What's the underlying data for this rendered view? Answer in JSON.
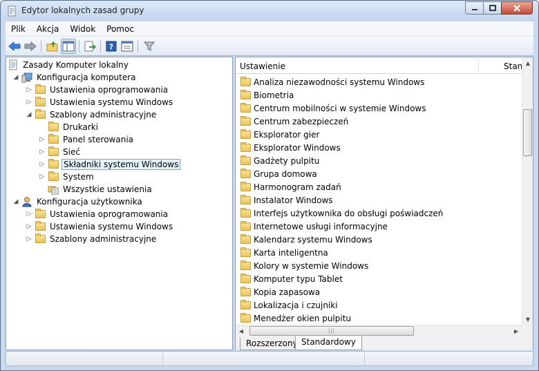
{
  "window": {
    "title": "Edytor lokalnych zasad grupy",
    "controls": [
      "minimize-icon",
      "maximize-icon",
      "close-icon"
    ]
  },
  "menu": [
    {
      "label": "Plik"
    },
    {
      "label": "Akcja"
    },
    {
      "label": "Widok"
    },
    {
      "label": "Pomoc"
    }
  ],
  "toolbar": {
    "icons": [
      "back-arrow-icon",
      "forward-arrow-icon",
      "up-folder-icon",
      "show-hide-tree-icon",
      "export-list-icon",
      "help-icon",
      "properties-icon",
      "filter-icon"
    ]
  },
  "tree": {
    "root": "Zasady Komputer lokalny",
    "computer": "Konfiguracja komputera",
    "computer_software": "Ustawienia oprogramowania",
    "computer_windows": "Ustawienia systemu Windows",
    "computer_admin": "Szablony administracyjne",
    "printers": "Drukarki",
    "control_panel": "Panel sterowania",
    "network": "Sieć",
    "win_components": "Składniki systemu Windows",
    "system": "System",
    "all_settings": "Wszystkie ustawienia",
    "user": "Konfiguracja użytkownika",
    "user_software": "Ustawienia oprogramowania",
    "user_windows": "Ustawienia systemu Windows",
    "user_admin": "Szablony administracyjne"
  },
  "list": {
    "col_setting": "Ustawienie",
    "col_state": "Stan",
    "items": [
      "Analiza niezawodności systemu Windows",
      "Biometria",
      "Centrum mobilności w systemie Windows",
      "Centrum zabezpieczeń",
      "Eksplorator gier",
      "Eksplorator Windows",
      "Gadżety pulpitu",
      "Grupa domowa",
      "Harmonogram zadań",
      "Instalator Windows",
      "Interfejs użytkownika do obsługi poświadczeń",
      "Internetowe usługi informacyjne",
      "Kalendarz systemu Windows",
      "Karta inteligentna",
      "Kolory w systemie Windows",
      "Komputer typu Tablet",
      "Kopia zapasowa",
      "Lokalizacja i czujniki",
      "Menedżer okien pulpitu"
    ]
  },
  "tabs": {
    "extended": "Rozszerzony",
    "standard": "Standardowy"
  }
}
